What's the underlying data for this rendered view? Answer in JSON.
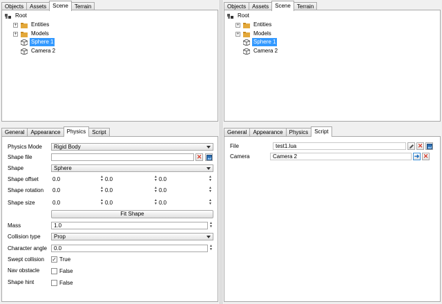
{
  "left": {
    "top_tabs": [
      "Objects",
      "Assets",
      "Scene",
      "Terrain"
    ],
    "top_active": 2,
    "tree": [
      {
        "label": "Root",
        "icon": "root-icon"
      },
      {
        "label": "Entities",
        "icon": "folder-icon",
        "expander": "+"
      },
      {
        "label": "Models",
        "icon": "folder-icon",
        "expander": "+"
      },
      {
        "label": "Sphere 1",
        "icon": "mesh-icon",
        "selected": true
      },
      {
        "label": "Camera 2",
        "icon": "mesh-icon"
      }
    ],
    "bottom_tabs": [
      "General",
      "Appearance",
      "Physics",
      "Script"
    ],
    "bottom_active": 2,
    "physics": {
      "physics_mode_label": "Physics Mode",
      "physics_mode_value": "Rigid Body",
      "shape_file_label": "Shape file",
      "shape_file_value": "",
      "shape_label": "Shape",
      "shape_value": "Sphere",
      "shape_offset_label": "Shape offset",
      "shape_offset": [
        "0.0",
        "0.0",
        "0.0"
      ],
      "shape_rotation_label": "Shape rotation",
      "shape_rotation": [
        "0.0",
        "0.0",
        "0.0"
      ],
      "shape_size_label": "Shape size",
      "shape_size": [
        "0.0",
        "0.0",
        "0.0"
      ],
      "fit_shape_label": "Fit Shape",
      "mass_label": "Mass",
      "mass_value": "1.0",
      "collision_type_label": "Collision type",
      "collision_type_value": "Prop",
      "character_angle_label": "Character angle",
      "character_angle_value": "0.0",
      "swept_collision_label": "Swept collision",
      "swept_collision_text": "True",
      "swept_collision_checked": true,
      "nav_obstacle_label": "Nav obstacle",
      "nav_obstacle_text": "False",
      "shape_hint_label": "Shape hint",
      "shape_hint_text": "False"
    }
  },
  "right": {
    "top_tabs": [
      "Objects",
      "Assets",
      "Scene",
      "Terrain"
    ],
    "top_active": 2,
    "tree": [
      {
        "label": "Root",
        "icon": "root-icon"
      },
      {
        "label": "Entities",
        "icon": "folder-icon",
        "expander": "+"
      },
      {
        "label": "Models",
        "icon": "folder-icon",
        "expander": "+"
      },
      {
        "label": "Sphere 1",
        "icon": "mesh-icon",
        "selected": true
      },
      {
        "label": "Camera 2",
        "icon": "mesh-icon"
      }
    ],
    "bottom_tabs": [
      "General",
      "Appearance",
      "Physics",
      "Script"
    ],
    "bottom_active": 3,
    "script": {
      "file_label": "File",
      "file_value": "test1.lua",
      "camera_label": "Camera",
      "camera_value": "Camera 2"
    }
  }
}
